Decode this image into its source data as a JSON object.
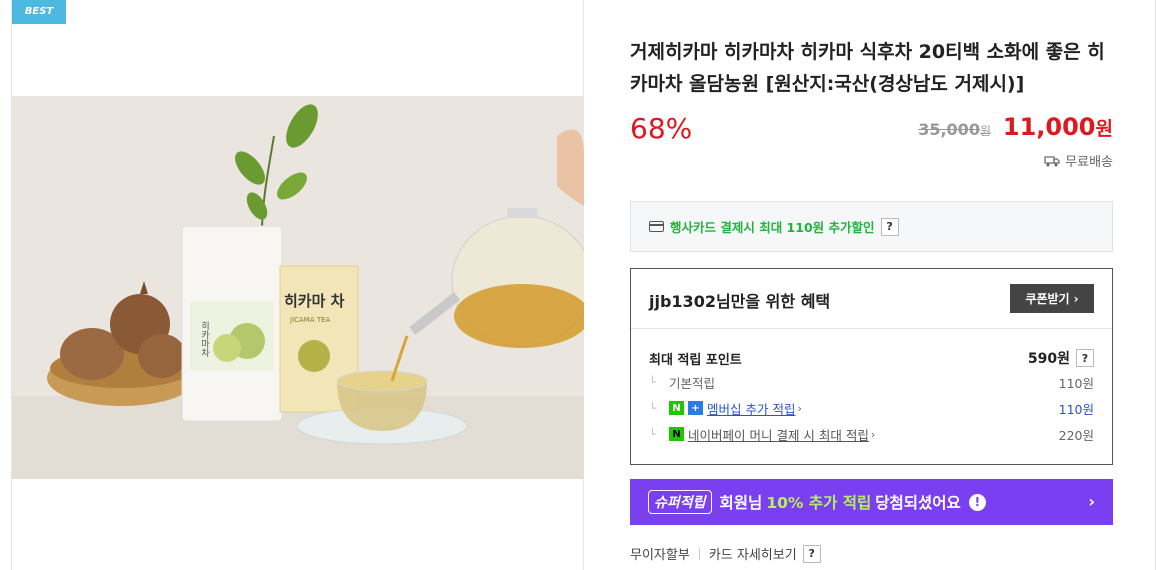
{
  "image_panel": {
    "best_badge": "BEST",
    "pouch_text": "히카마차",
    "box_text": "히카마 차",
    "box_subtext": "JICAMA TEA"
  },
  "product": {
    "title": "거제히카마 히카마차 히카마 식후차 20티백 소화에 좋은 히카마차 올담농원 [원산지:국산(경상남도 거제시)]",
    "discount_rate": "68%",
    "original_price": "35,000",
    "original_price_unit": "원",
    "sale_price": "11,000",
    "sale_price_unit": "원",
    "shipping": "무료배송"
  },
  "card_promo": {
    "text": "행사카드 결제시 최대 110원 추가할인",
    "help": "?"
  },
  "benefit": {
    "title": "jjb1302님만을 위한 혜택",
    "coupon_button": "쿠폰받기",
    "coupon_chevron": "›",
    "max_points_label": "최대 적립 포인트",
    "max_points_value": "590원",
    "help": "?",
    "rows": [
      {
        "branch": "└",
        "label": "기본적립",
        "value": "110원"
      },
      {
        "branch": "└",
        "badge1": "N",
        "badge2": "+",
        "label": "멤버십 추가 적립",
        "chevron": "›",
        "value": "110원"
      },
      {
        "branch": "└",
        "badge1": "N",
        "label": "네이버페이 머니 결제 시 최대 적립",
        "chevron": "›",
        "value": "220원"
      }
    ]
  },
  "super_banner": {
    "tag": "슈퍼적립",
    "text_before": "회원님",
    "highlight": "10% 추가 적립",
    "text_after": "당첨되셨어요",
    "exclaim": "!",
    "arrow": "›"
  },
  "bottom_links": {
    "installment": "무이자할부",
    "card_detail": "카드 자세히보기",
    "help": "?"
  },
  "colors": {
    "accent_red": "#e0171f",
    "green": "#1fb43c",
    "purple": "#7a3ff0",
    "blue_link": "#2c54c8",
    "badge_blue": "#4db8e0"
  }
}
